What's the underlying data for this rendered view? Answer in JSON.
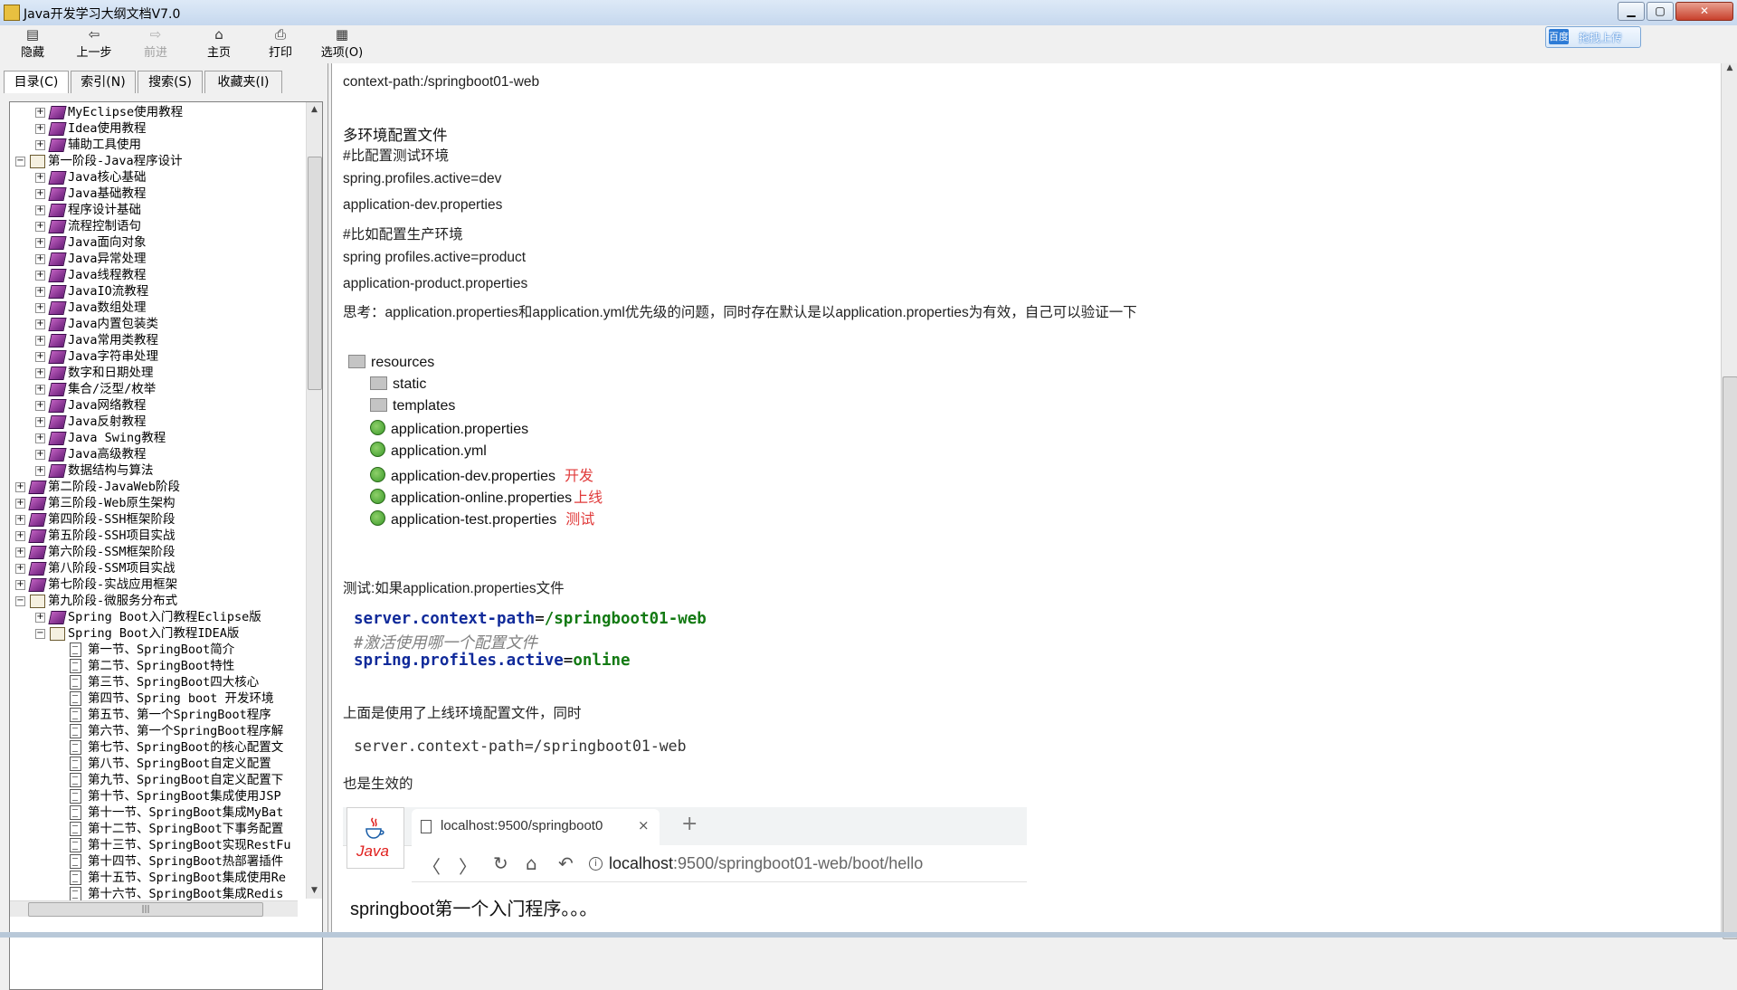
{
  "window": {
    "title": "Java开发学习大纲文档V7.0",
    "min": "▁",
    "max": "▢",
    "close": "✕"
  },
  "toolbar": [
    {
      "label": "隐藏",
      "icon": "hide-icon"
    },
    {
      "label": "上一步",
      "icon": "back-arrow-icon"
    },
    {
      "label": "前进",
      "icon": "forward-arrow-icon"
    },
    {
      "label": "主页",
      "icon": "home-icon"
    },
    {
      "label": "打印",
      "icon": "print-icon"
    },
    {
      "label": "选项(O)",
      "icon": "options-icon"
    }
  ],
  "upload": {
    "badge": "百度",
    "label": "拖拽上传"
  },
  "tabs": [
    "目录(C)",
    "索引(N)",
    "搜索(S)",
    "收藏夹(I)"
  ],
  "tree": [
    {
      "level": 1,
      "exp": "+",
      "icon": "closed",
      "text": "MyEclipse使用教程"
    },
    {
      "level": 1,
      "exp": "+",
      "icon": "closed",
      "text": "Idea使用教程"
    },
    {
      "level": 1,
      "exp": "+",
      "icon": "closed",
      "text": "辅助工具使用"
    },
    {
      "level": 0,
      "exp": "-",
      "icon": "open",
      "text": "第一阶段-Java程序设计"
    },
    {
      "level": 1,
      "exp": "+",
      "icon": "closed",
      "text": "Java核心基础"
    },
    {
      "level": 1,
      "exp": "+",
      "icon": "closed",
      "text": "Java基础教程"
    },
    {
      "level": 1,
      "exp": "+",
      "icon": "closed",
      "text": "程序设计基础"
    },
    {
      "level": 1,
      "exp": "+",
      "icon": "closed",
      "text": "流程控制语句"
    },
    {
      "level": 1,
      "exp": "+",
      "icon": "closed",
      "text": "Java面向对象"
    },
    {
      "level": 1,
      "exp": "+",
      "icon": "closed",
      "text": "Java异常处理"
    },
    {
      "level": 1,
      "exp": "+",
      "icon": "closed",
      "text": "Java线程教程"
    },
    {
      "level": 1,
      "exp": "+",
      "icon": "closed",
      "text": "JavaIO流教程"
    },
    {
      "level": 1,
      "exp": "+",
      "icon": "closed",
      "text": "Java数组处理"
    },
    {
      "level": 1,
      "exp": "+",
      "icon": "closed",
      "text": "Java内置包装类"
    },
    {
      "level": 1,
      "exp": "+",
      "icon": "closed",
      "text": "Java常用类教程"
    },
    {
      "level": 1,
      "exp": "+",
      "icon": "closed",
      "text": "Java字符串处理"
    },
    {
      "level": 1,
      "exp": "+",
      "icon": "closed",
      "text": "数字和日期处理"
    },
    {
      "level": 1,
      "exp": "+",
      "icon": "closed",
      "text": "集合/泛型/枚举"
    },
    {
      "level": 1,
      "exp": "+",
      "icon": "closed",
      "text": "Java网络教程"
    },
    {
      "level": 1,
      "exp": "+",
      "icon": "closed",
      "text": "Java反射教程"
    },
    {
      "level": 1,
      "exp": "+",
      "icon": "closed",
      "text": "Java Swing教程"
    },
    {
      "level": 1,
      "exp": "+",
      "icon": "closed",
      "text": "Java高级教程"
    },
    {
      "level": 1,
      "exp": "+",
      "icon": "closed",
      "text": "数据结构与算法"
    },
    {
      "level": 0,
      "exp": "+",
      "icon": "closed",
      "text": "第二阶段-JavaWeb阶段"
    },
    {
      "level": 0,
      "exp": "+",
      "icon": "closed",
      "text": "第三阶段-Web原生架构"
    },
    {
      "level": 0,
      "exp": "+",
      "icon": "closed",
      "text": "第四阶段-SSH框架阶段"
    },
    {
      "level": 0,
      "exp": "+",
      "icon": "closed",
      "text": "第五阶段-SSH项目实战"
    },
    {
      "level": 0,
      "exp": "+",
      "icon": "closed",
      "text": "第六阶段-SSM框架阶段"
    },
    {
      "level": 0,
      "exp": "+",
      "icon": "closed",
      "text": "第八阶段-SSM项目实战"
    },
    {
      "level": 0,
      "exp": "+",
      "icon": "closed",
      "text": "第七阶段-实战应用框架"
    },
    {
      "level": 0,
      "exp": "-",
      "icon": "open",
      "text": "第九阶段-微服务分布式"
    },
    {
      "level": 1,
      "exp": "+",
      "icon": "closed",
      "text": "Spring Boot入门教程Eclipse版"
    },
    {
      "level": 1,
      "exp": "-",
      "icon": "open",
      "text": "Spring Boot入门教程IDEA版"
    },
    {
      "level": 2,
      "exp": "",
      "icon": "page",
      "text": "第一节、SpringBoot简介"
    },
    {
      "level": 2,
      "exp": "",
      "icon": "page",
      "text": "第二节、SpringBoot特性"
    },
    {
      "level": 2,
      "exp": "",
      "icon": "page",
      "text": "第三节、SpringBoot四大核心"
    },
    {
      "level": 2,
      "exp": "",
      "icon": "page",
      "text": "第四节、Spring boot 开发环境"
    },
    {
      "level": 2,
      "exp": "",
      "icon": "page",
      "text": "第五节、第一个SpringBoot程序"
    },
    {
      "level": 2,
      "exp": "",
      "icon": "page",
      "text": "第六节、第一个SpringBoot程序解"
    },
    {
      "level": 2,
      "exp": "",
      "icon": "page",
      "text": "第七节、SpringBoot的核心配置文"
    },
    {
      "level": 2,
      "exp": "",
      "icon": "page",
      "text": "第八节、SpringBoot自定义配置"
    },
    {
      "level": 2,
      "exp": "",
      "icon": "page",
      "text": "第九节、SpringBoot自定义配置下"
    },
    {
      "level": 2,
      "exp": "",
      "icon": "page",
      "text": "第十节、SpringBoot集成使用JSP"
    },
    {
      "level": 2,
      "exp": "",
      "icon": "page",
      "text": "第十一节、SpringBoot集成MyBat"
    },
    {
      "level": 2,
      "exp": "",
      "icon": "page",
      "text": "第十二节、SpringBoot下事务配置"
    },
    {
      "level": 2,
      "exp": "",
      "icon": "page",
      "text": "第十三节、SpringBoot实现RestFu"
    },
    {
      "level": 2,
      "exp": "",
      "icon": "page",
      "text": "第十四节、SpringBoot热部署插件"
    },
    {
      "level": 2,
      "exp": "",
      "icon": "page",
      "text": "第十五节、SpringBoot集成使用Re"
    },
    {
      "level": 2,
      "exp": "",
      "icon": "page",
      "text": "第十六节、SpringBoot集成Redis"
    }
  ],
  "content": {
    "line_context": "context-path:/springboot01-web",
    "heading": "多环境配置文件",
    "lines": [
      "#比配置测试环境",
      "spring.profiles.active=dev",
      "application-dev.properties",
      "#比如配置生产环境",
      "spring profiles.active=product",
      "application-product.properties",
      "思考：application.properties和application.yml优先级的问题，同时存在默认是以application.properties为有效，自己可以验证一下"
    ],
    "files": [
      {
        "type": "folder",
        "name": "resources",
        "tag": ""
      },
      {
        "type": "folder",
        "name": "static",
        "tag": ""
      },
      {
        "type": "folder",
        "name": "templates",
        "tag": ""
      },
      {
        "type": "leaf",
        "name": "application.properties",
        "tag": ""
      },
      {
        "type": "leaf",
        "name": "application.yml",
        "tag": ""
      },
      {
        "type": "leaf",
        "name": "application-dev.properties",
        "tag": "开发"
      },
      {
        "type": "leaf",
        "name": "application-online.properties",
        "tag": "上线"
      },
      {
        "type": "leaf",
        "name": "application-test.properties",
        "tag": "测试"
      }
    ],
    "test_line": "测试:如果application.properties文件",
    "code": {
      "line1_key": "server.context-path",
      "line1_val": "/springboot01-web",
      "comment": "#激活使用哪一个配置文件",
      "line3_key": "spring.profiles.active",
      "line3_val": "online"
    },
    "above_line": "上面是使用了上线环境配置文件，同时",
    "code2": "server.context-path=/springboot01-web",
    "effective": "也是生效的",
    "browser": {
      "tab_title": "localhost:9500/springboot0",
      "tab_close": "×",
      "new_tab": "+",
      "url_host": "localhost",
      "url_path": ":9500/springboot01-web/boot/hello",
      "logo_text": "Java",
      "body": "springboot第一个入门程序。。。"
    }
  }
}
